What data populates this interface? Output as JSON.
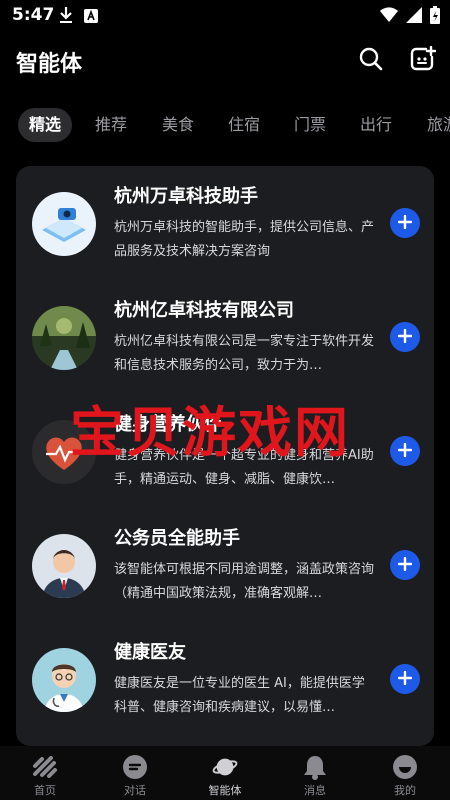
{
  "status": {
    "time": "5:47"
  },
  "header": {
    "title": "智能体"
  },
  "tabs": [
    {
      "label": "精选",
      "active": true
    },
    {
      "label": "推荐"
    },
    {
      "label": "美食"
    },
    {
      "label": "住宿"
    },
    {
      "label": "门票"
    },
    {
      "label": "出行"
    },
    {
      "label": "旅游"
    }
  ],
  "agents": [
    {
      "title": "杭州万卓科技助手",
      "desc": "杭州万卓科技的智能助手，提供公司信息、产品服务及技术解决方案咨询",
      "icon": "tech-device-avatar"
    },
    {
      "title": "杭州亿卓科技有限公司",
      "desc": "杭州亿卓科技有限公司是一家专注于软件开发和信息技术服务的公司，致力于为…",
      "icon": "forest-stream-avatar"
    },
    {
      "title": "健身营养伙伴",
      "desc": "健身营养伙伴是一个超专业的健身和营养AI助手，精通运动、健身、减脂、健康饮…",
      "icon": "heart-pulse-avatar"
    },
    {
      "title": "公务员全能助手",
      "desc": "该智能体可根据不同用途调整，涵盖政策咨询（精通中国政策法规，准确客观解…",
      "icon": "official-person-avatar"
    },
    {
      "title": "健康医友",
      "desc": "健康医友是一位专业的医生 AI，能提供医学科普、健康咨询和疾病建议，以易懂…",
      "icon": "doctor-avatar"
    }
  ],
  "watermark": "宝贝游戏网",
  "nav": [
    {
      "label": "首页"
    },
    {
      "label": "对话"
    },
    {
      "label": "智能体",
      "active": true
    },
    {
      "label": "消息"
    },
    {
      "label": "我的"
    }
  ],
  "colors": {
    "accent": "#1e5ae8",
    "watermark": "#e0161c",
    "card": "#1c1d20"
  }
}
